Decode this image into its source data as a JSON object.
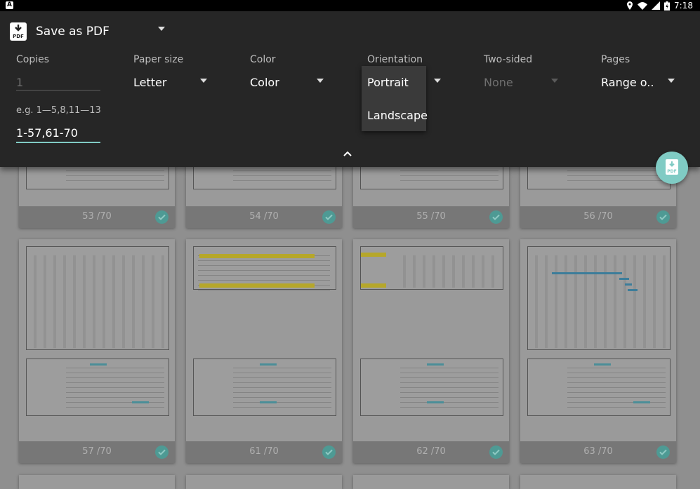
{
  "status_bar": {
    "time": "7:18"
  },
  "destination": {
    "label": "Save as PDF"
  },
  "options": {
    "copies": {
      "label": "Copies",
      "placeholder": "1"
    },
    "paper_size": {
      "label": "Paper size",
      "value": "Letter"
    },
    "color": {
      "label": "Color",
      "value": "Color"
    },
    "orientation": {
      "label": "Orientation",
      "value": "Portrait"
    },
    "two_sided": {
      "label": "Two-sided",
      "value": "None"
    },
    "pages": {
      "label": "Pages",
      "value": "Range o.."
    }
  },
  "range": {
    "hint": "e.g. 1—5,8,11—13",
    "value": "1-57,61-70"
  },
  "orientation_menu": {
    "items": [
      "Portrait",
      "Landscape"
    ]
  },
  "previews": [
    {
      "label": "53 /70"
    },
    {
      "label": "54 /70"
    },
    {
      "label": "55 /70"
    },
    {
      "label": "56 /70"
    },
    {
      "label": "57 /70"
    },
    {
      "label": "61 /70"
    },
    {
      "label": "62 /70"
    },
    {
      "label": "63 /70"
    }
  ],
  "colors": {
    "accent": "#80cbc4",
    "panel": "#262626",
    "scrim": "#8f8f8f"
  }
}
